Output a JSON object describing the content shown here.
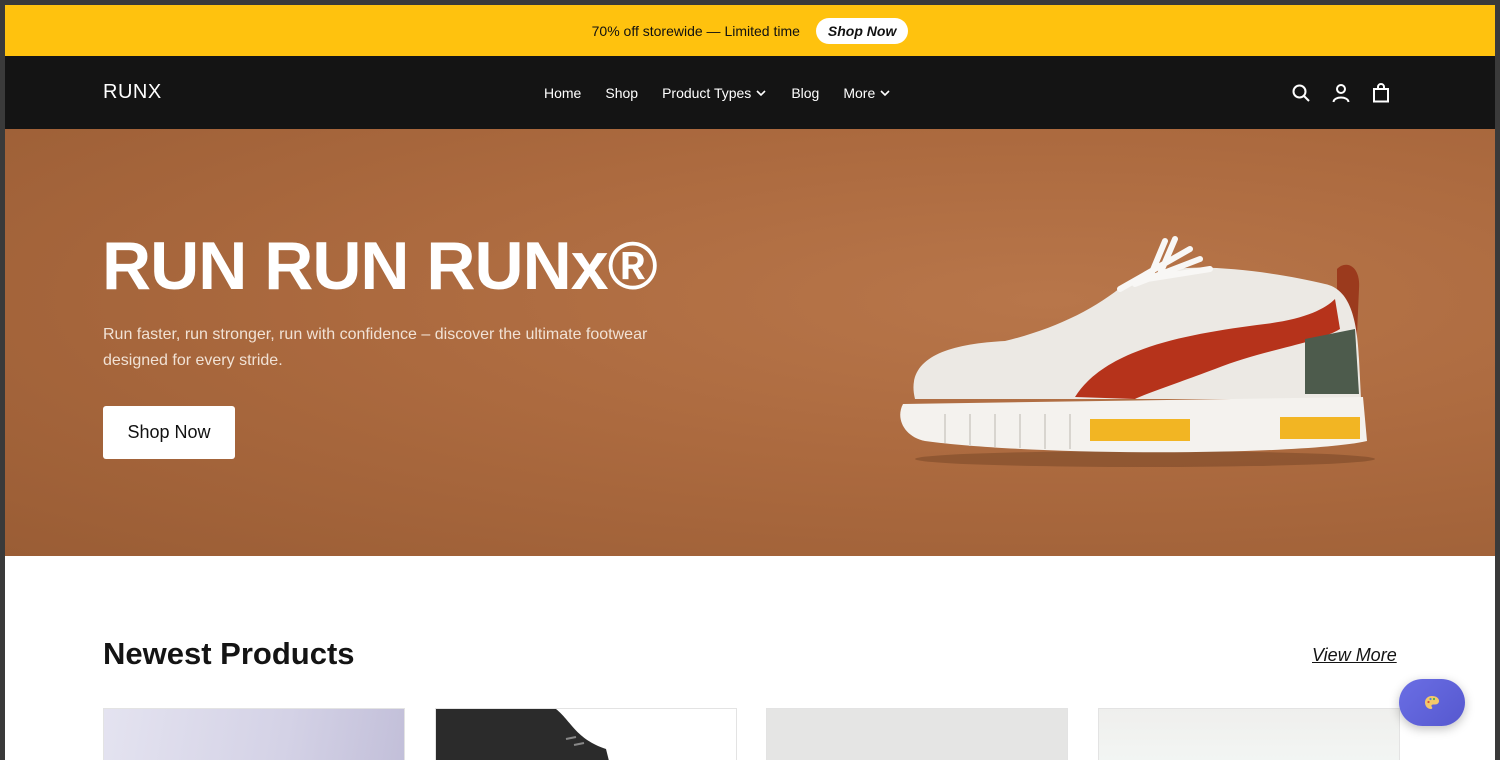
{
  "announcement": {
    "text": "70% off storewide — Limited time",
    "cta_label": "Shop Now"
  },
  "header": {
    "logo": "RUNX",
    "nav": [
      {
        "label": "Home",
        "has_dropdown": false
      },
      {
        "label": "Shop",
        "has_dropdown": false
      },
      {
        "label": "Product Types",
        "has_dropdown": true
      },
      {
        "label": "Blog",
        "has_dropdown": false
      },
      {
        "label": "More",
        "has_dropdown": true
      }
    ],
    "icons": [
      "search-icon",
      "account-icon",
      "cart-icon"
    ]
  },
  "hero": {
    "title": "RUN RUN RUNx®",
    "subtitle": "Run faster, run stronger, run with confidence – discover the ultimate footwear designed for every stride.",
    "button_label": "Shop Now",
    "background_color": "#ac6a3f"
  },
  "products": {
    "title": "Newest Products",
    "view_more_label": "View More"
  },
  "colors": {
    "announcement_bg": "#ffc20e",
    "header_bg": "#141414",
    "fab_bg": "#5f63dc"
  },
  "fab": {
    "icon": "palette-icon"
  }
}
